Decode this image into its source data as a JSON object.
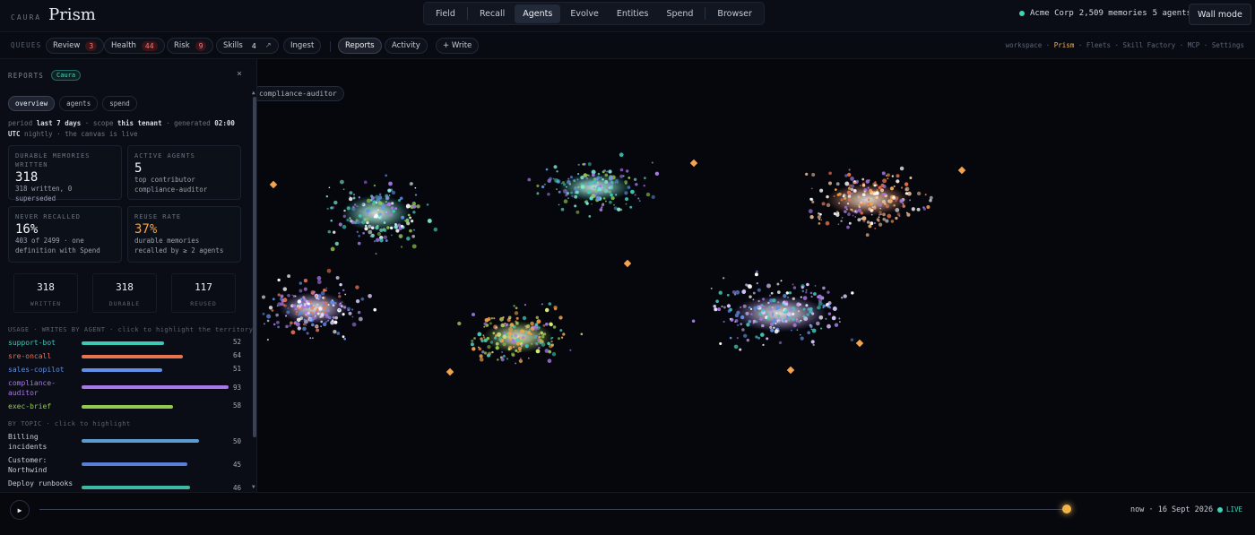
{
  "header": {
    "brand_small": "CAURA",
    "brand_big": "Prism",
    "nav": [
      {
        "label": "Field",
        "active": false
      },
      {
        "label": "Recall",
        "active": false
      },
      {
        "label": "Agents",
        "active": true
      },
      {
        "label": "Evolve",
        "active": false
      },
      {
        "label": "Entities",
        "active": false
      },
      {
        "label": "Spend",
        "active": false
      },
      {
        "label": "Browser",
        "active": false
      }
    ],
    "tenant": "Acme Corp",
    "memories": "2,509 memories",
    "agents": "5 agents",
    "wall_mode": "Wall mode"
  },
  "queues": {
    "label": "QUEUES",
    "items": [
      {
        "label": "Review",
        "count": "3"
      },
      {
        "label": "Health",
        "count": "44"
      },
      {
        "label": "Risk",
        "count": "9"
      },
      {
        "label": "Skills",
        "count": "4"
      }
    ],
    "skills_arrow": "↗",
    "ingest": "Ingest",
    "reports": "Reports",
    "activity": "Activity",
    "write": "+ Write",
    "crumbs": {
      "workspace": "workspace",
      "prism": "Prism",
      "fleets": "Fleets",
      "skill_factory": "Skill Factory",
      "mcp": "MCP",
      "settings": "Settings",
      "sep": "·"
    }
  },
  "sidebar": {
    "title": "REPORTS",
    "badge": "Caura",
    "close": "×",
    "tabs": [
      "overview",
      "agents",
      "spend"
    ],
    "period": {
      "p1": "period ",
      "b1": "last 7 days",
      "p2": " · scope ",
      "b2": "this tenant",
      "p3": " · generated ",
      "b3": "02:00",
      "b4": "UTC",
      "p4": " nightly · the canvas is live"
    },
    "cards": {
      "durable": {
        "label": "DURABLE MEMORIES WRITTEN",
        "value": "318",
        "sub": "318 written, 0 superseded"
      },
      "active": {
        "label": "ACTIVE AGENTS",
        "value": "5",
        "sub1": "top contributor",
        "sub2": "compliance-auditor"
      },
      "never": {
        "label": "NEVER RECALLED",
        "value": "16%",
        "sub": "403 of 2499 · one definition with Spend"
      },
      "reuse": {
        "label": "REUSE RATE",
        "value": "37%",
        "sub": "durable memories recalled by ≥ 2 agents"
      }
    },
    "stats": [
      {
        "num": "318",
        "cap": "WRITTEN"
      },
      {
        "num": "318",
        "cap": "DURABLE"
      },
      {
        "num": "117",
        "cap": "REUSED"
      }
    ],
    "usage_title": "USAGE · WRITES BY AGENT · click to highlight the territory",
    "usage": [
      {
        "name": "support-bot",
        "value": 52,
        "color": "#3ec9b6",
        "fill": 0.56
      },
      {
        "name": "sre-oncall",
        "value": 64,
        "color": "#e8734f",
        "fill": 0.69
      },
      {
        "name": "sales-copilot",
        "value": 51,
        "color": "#5f8fe6",
        "fill": 0.55
      },
      {
        "name": "compliance-auditor",
        "value": 93,
        "color": "#a878e6",
        "fill": 1.0
      },
      {
        "name": "exec-brief",
        "value": 58,
        "color": "#93c94e",
        "fill": 0.62
      }
    ],
    "topic_title": "BY TOPIC · click to highlight",
    "topics": [
      {
        "name": "Billing incidents",
        "value": 50,
        "color": "#5b9bd0",
        "fill": 0.8
      },
      {
        "name": "Customer: Northwind",
        "value": 45,
        "color": "#5a7fd6",
        "fill": 0.72
      },
      {
        "name": "Deploy runbooks",
        "value": 46,
        "color": "#3ab9a5",
        "fill": 0.74
      }
    ]
  },
  "canvas": {
    "tag": "compliance-auditor"
  },
  "timeline": {
    "play": "▶",
    "now": "now · 16 Sept 2026",
    "live": "LIVE"
  }
}
